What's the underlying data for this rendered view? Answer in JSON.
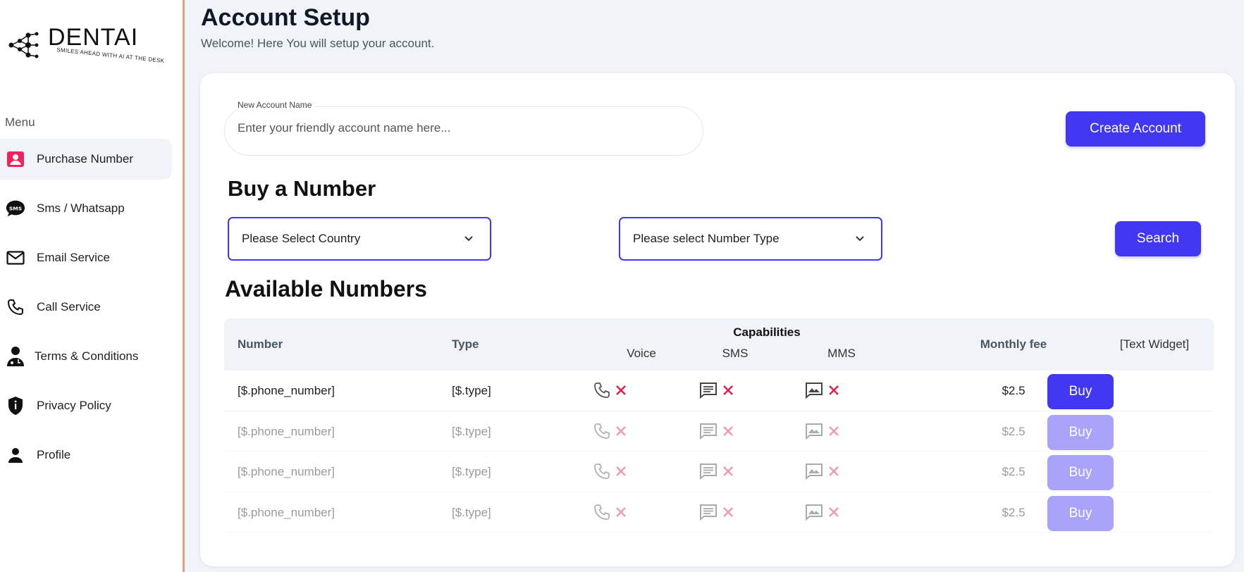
{
  "sidebar": {
    "logo": {
      "brand": "DENTAI",
      "tagline": "SMILES AHEAD WITH AI AT THE DESK"
    },
    "menu_title": "Menu",
    "items": [
      {
        "label": "Purchase Number",
        "icon": "account-box-icon",
        "active": true
      },
      {
        "label": "Sms / Whatsapp",
        "icon": "sms-bubble-icon",
        "active": false
      },
      {
        "label": "Email Service",
        "icon": "envelope-icon",
        "active": false
      },
      {
        "label": "Call Service",
        "icon": "phone-icon",
        "active": false
      },
      {
        "label": "Terms & Conditions",
        "icon": "doctor-icon",
        "active": false
      },
      {
        "label": "Privacy Policy",
        "icon": "shield-icon",
        "active": false
      },
      {
        "label": "Profile",
        "icon": "person-icon",
        "active": false
      }
    ]
  },
  "header": {
    "title": "Account Setup",
    "subtitle": "Welcome! Here You will setup your account."
  },
  "account": {
    "label": "New Account Name",
    "placeholder": "Enter your friendly account name here...",
    "value": "",
    "create_label": "Create Account"
  },
  "buy": {
    "title": "Buy a Number",
    "country_select": "Please Select Country",
    "type_select": "Please select Number Type",
    "search_label": "Search"
  },
  "available": {
    "title": "Available Numbers",
    "headers": {
      "number": "Number",
      "type": "Type",
      "capabilities": "Capabilities",
      "voice": "Voice",
      "sms": "SMS",
      "mms": "MMS",
      "fee": "Monthly fee",
      "widget": "[Text Widget]"
    },
    "rows": [
      {
        "number": "[$.phone_number]",
        "type": "[$.type]",
        "fee": "$2.5",
        "buy": "Buy"
      },
      {
        "number": "[$.phone_number]",
        "type": "[$.type]",
        "fee": "$2.5",
        "buy": "Buy"
      },
      {
        "number": "[$.phone_number]",
        "type": "[$.type]",
        "fee": "$2.5",
        "buy": "Buy"
      },
      {
        "number": "[$.phone_number]",
        "type": "[$.type]",
        "fee": "$2.5",
        "buy": "Buy"
      }
    ]
  },
  "colors": {
    "accent": "#4338f2",
    "danger": "#e11d48",
    "sidebar_border": "#e8a07a",
    "background": "#f0f3f8"
  }
}
